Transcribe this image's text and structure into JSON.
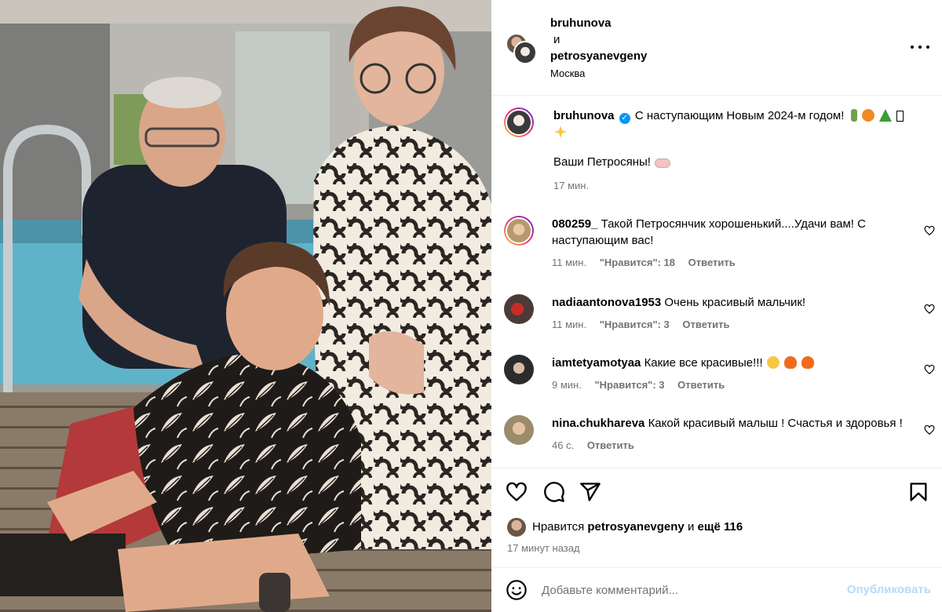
{
  "header": {
    "user1": "bruhunova",
    "and": "и",
    "user2": "petrosyanevgeny",
    "location": "Москва"
  },
  "caption": {
    "username": "bruhunova",
    "text": "С наступающим Новым 2024-м годом!",
    "emojis": [
      "bottle-emoji",
      "tangerine-emoji",
      "tree-emoji",
      "sparkles-emoji"
    ],
    "sign": "Ваши Петросяны!",
    "time": "17 мин."
  },
  "comments": [
    {
      "username": "080259_",
      "text": "Такой Петросянчик хорошенький....Удачи вам! С наступающим вас!",
      "time": "11 мин.",
      "likes": "\"Нравится\": 18",
      "reply": "Ответить"
    },
    {
      "username": "nadiaantonova1953",
      "text": "Очень красивый мальчик!",
      "time": "11 мин.",
      "likes": "\"Нравится\": 3",
      "reply": "Ответить"
    },
    {
      "username": "iamtetyamotyaa",
      "text": "Какие все красивые!!!",
      "time": "9 мин.",
      "likes": "\"Нравится\": 3",
      "reply": "Ответить"
    },
    {
      "username": "nina.chukhareva",
      "text": "Какой красивый малыш ! Счастья и здоровья !",
      "time": "46 с.",
      "likes": "",
      "reply": "Ответить"
    }
  ],
  "likes": {
    "prefix": "Нравится",
    "user": "petrosyanevgeny",
    "and": "и",
    "more": "ещё 116"
  },
  "post_time": "17 минут назад",
  "comment_box": {
    "placeholder": "Добавьте комментарий...",
    "publish": "Опубликовать"
  },
  "colors": {
    "link_blue": "#0095f6",
    "publish_disabled": "#b3dbff",
    "meta_gray": "#737373"
  }
}
